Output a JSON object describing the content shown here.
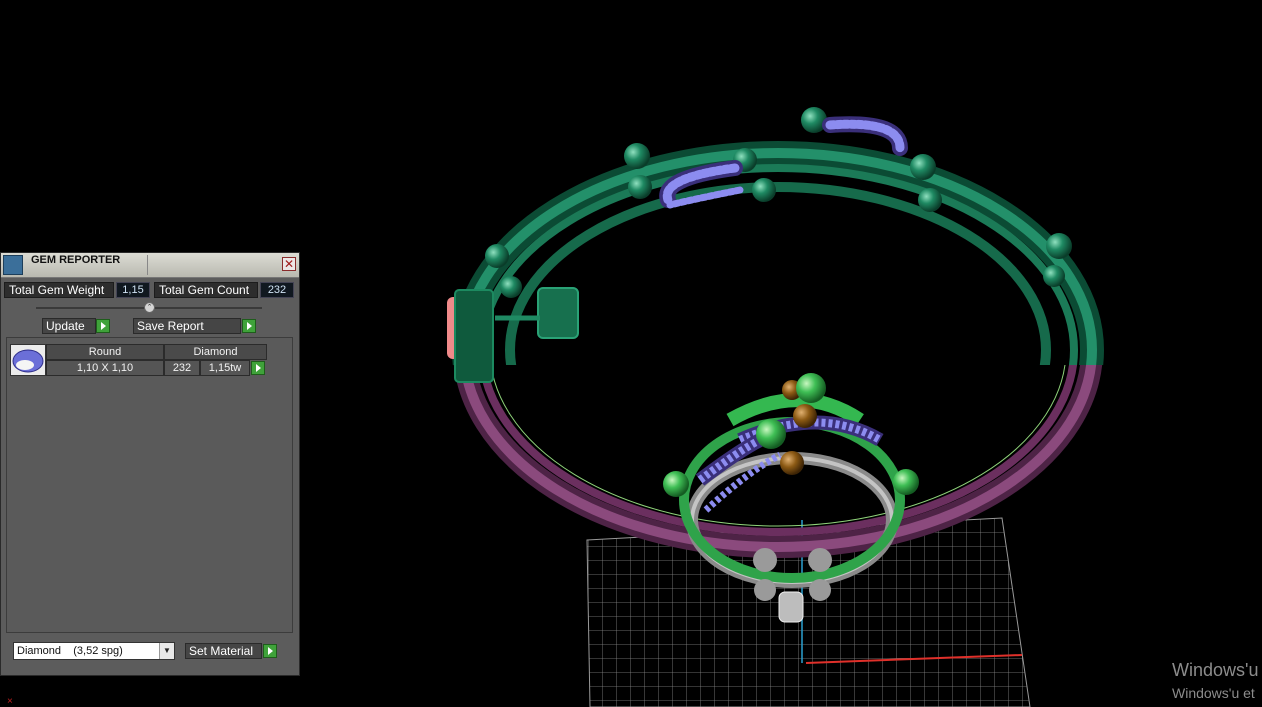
{
  "panel": {
    "title": "GEM REPORTER",
    "close_glyph": "✕",
    "total_weight_label": "Total Gem Weight",
    "total_weight_value": "1,15",
    "total_count_label": "Total Gem Count",
    "total_count_value": "232",
    "update_label": "Update",
    "save_report_label": "Save Report",
    "table": {
      "col_shape": "Round",
      "col_material": "Diamond",
      "row": {
        "size": "1,10 X 1,10",
        "count": "232",
        "weight": "1,15tw"
      }
    },
    "material_select": "Diamond    (3,52 spg)",
    "set_material_label": "Set Material"
  },
  "watermark": {
    "line1": "Windows'u",
    "line2": "Windows'u et"
  },
  "colors": {
    "green_rail": "#1f7d5c",
    "purple_rail": "#7b3e6d",
    "gem_blue": "#7f7ee8",
    "brown_bead": "#8c5a14",
    "play_button": "#3fa23a"
  }
}
